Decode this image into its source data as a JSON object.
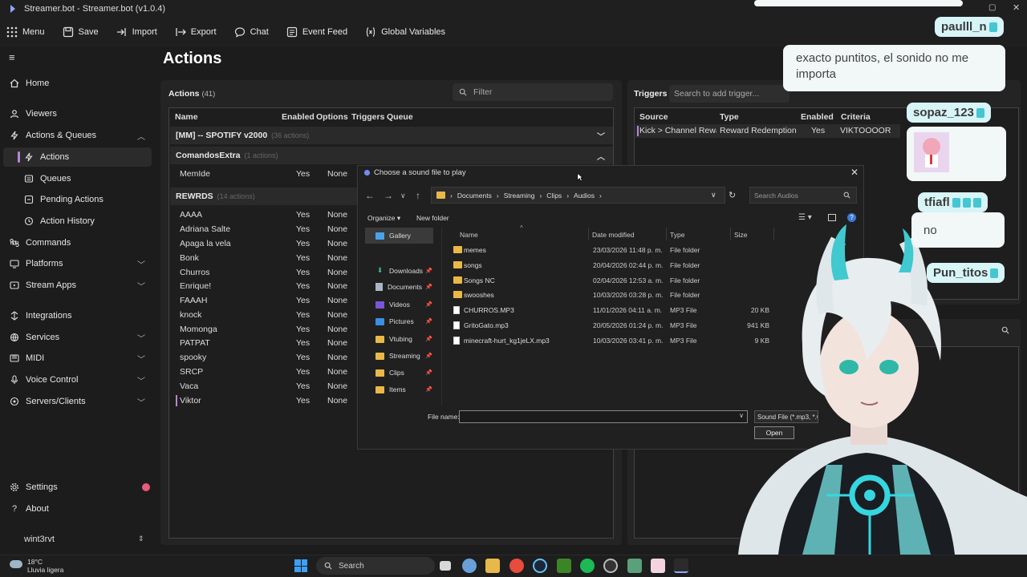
{
  "window": {
    "title": "Streamer.bot - Streamer.bot (v1.0.4)"
  },
  "toolbar": [
    "Menu",
    "Save",
    "Import",
    "Export",
    "Chat",
    "Event Feed",
    "Global Variables"
  ],
  "sidebar": {
    "items": [
      {
        "label": "Home",
        "icon": "home-icon"
      },
      {
        "label": "Viewers",
        "icon": "viewers-icon"
      },
      {
        "label": "Actions & Queues",
        "icon": "bolt-icon",
        "expanded": true
      },
      {
        "label": "Actions",
        "icon": "bolt-icon",
        "active": true
      },
      {
        "label": "Queues",
        "icon": "queue-icon"
      },
      {
        "label": "Pending Actions",
        "icon": "pending-icon"
      },
      {
        "label": "Action History",
        "icon": "history-icon"
      },
      {
        "label": "Commands",
        "icon": "command-icon"
      },
      {
        "label": "Platforms",
        "icon": "platform-icon"
      },
      {
        "label": "Stream Apps",
        "icon": "apps-icon"
      },
      {
        "label": "Integrations",
        "icon": "integrations-icon"
      },
      {
        "label": "Services",
        "icon": "services-icon"
      },
      {
        "label": "MIDI",
        "icon": "midi-icon"
      },
      {
        "label": "Voice Control",
        "icon": "voice-icon"
      },
      {
        "label": "Servers/Clients",
        "icon": "server-icon"
      },
      {
        "label": "Settings",
        "icon": "gear-icon"
      },
      {
        "label": "About",
        "icon": "question-icon"
      }
    ],
    "profile": "wint3rvt"
  },
  "main": {
    "title": "Actions",
    "actions_header": "Actions",
    "actions_count": "(41)",
    "filter_placeholder": "Filter",
    "columns": [
      "Name",
      "Enabled",
      "Options",
      "Triggers",
      "Queue"
    ],
    "groups": [
      {
        "name": "[MM] -- SPOTIFY v2000",
        "count": "(36 actions)"
      },
      {
        "name": "ComandosExtra",
        "count": "(1 actions)",
        "items": [
          {
            "name": "MemIde",
            "enabled": "Yes",
            "options": "None"
          }
        ]
      },
      {
        "name": "REWRDS",
        "count": "(14 actions)",
        "items": [
          {
            "name": "AAAA",
            "enabled": "Yes",
            "options": "None"
          },
          {
            "name": "Adriana Salte",
            "enabled": "Yes",
            "options": "None"
          },
          {
            "name": "Apaga la vela",
            "enabled": "Yes",
            "options": "None"
          },
          {
            "name": "Bonk",
            "enabled": "Yes",
            "options": "None"
          },
          {
            "name": "Churros",
            "enabled": "Yes",
            "options": "None"
          },
          {
            "name": "Enrique!",
            "enabled": "Yes",
            "options": "None"
          },
          {
            "name": "FAAAH",
            "enabled": "Yes",
            "options": "None"
          },
          {
            "name": "knock",
            "enabled": "Yes",
            "options": "None"
          },
          {
            "name": "Momonga",
            "enabled": "Yes",
            "options": "None"
          },
          {
            "name": "PATPAT",
            "enabled": "Yes",
            "options": "None"
          },
          {
            "name": "spooky",
            "enabled": "Yes",
            "options": "None"
          },
          {
            "name": "SRCP",
            "enabled": "Yes",
            "options": "None"
          },
          {
            "name": "Vaca",
            "enabled": "Yes",
            "options": "None"
          },
          {
            "name": "Viktor",
            "enabled": "Yes",
            "options": "None"
          }
        ]
      }
    ]
  },
  "triggers": {
    "header": "Triggers",
    "search_placeholder": "Search to add trigger...",
    "columns": [
      "Source",
      "Type",
      "Enabled",
      "Criteria"
    ],
    "row": {
      "source": "Kick > Channel Reward",
      "type": "Reward Redemption",
      "enabled": "Yes",
      "criteria": "VIKTOOOOR"
    }
  },
  "dialog": {
    "title": "Choose a sound file to play",
    "path": [
      "Documents",
      "Streaming",
      "Clips",
      "Audios"
    ],
    "search_placeholder": "Search Audios",
    "organize": "Organize",
    "new_folder": "New folder",
    "nav": [
      "Gallery",
      "Downloads",
      "Documents",
      "Videos",
      "Pictures",
      "Vtubing",
      "Streaming",
      "Clips",
      "Items"
    ],
    "columns": [
      "Name",
      "Date modified",
      "Type",
      "Size"
    ],
    "files": [
      {
        "name": "memes",
        "date": "23/03/2026 11:48 p. m.",
        "type": "File folder",
        "size": "",
        "kind": "folder"
      },
      {
        "name": "songs",
        "date": "20/04/2026 02:44 p. m.",
        "type": "File folder",
        "size": "",
        "kind": "folder"
      },
      {
        "name": "Songs NC",
        "date": "02/04/2026 12:53 a. m.",
        "type": "File folder",
        "size": "",
        "kind": "folder"
      },
      {
        "name": "swooshes",
        "date": "10/03/2026 03:28 p. m.",
        "type": "File folder",
        "size": "",
        "kind": "folder"
      },
      {
        "name": "CHURROS.MP3",
        "date": "11/01/2026 04:11 a. m.",
        "type": "MP3 File",
        "size": "20 KB",
        "kind": "file"
      },
      {
        "name": "GritoGato.mp3",
        "date": "20/05/2026 01:24 p. m.",
        "type": "MP3 File",
        "size": "941 KB",
        "kind": "file"
      },
      {
        "name": "minecraft-hurt_kg1jeLX.mp3",
        "date": "10/03/2026 03:41 p. m.",
        "type": "MP3 File",
        "size": "9 KB",
        "kind": "file"
      }
    ],
    "filename_label": "File name:",
    "filename_value": "",
    "filetype": "Sound File (*.mp3, *.w",
    "open": "Open"
  },
  "chat": [
    {
      "user": "paulll_n",
      "message": "exacto puntitos, el sonido no me importa"
    },
    {
      "user": "sopaz_123",
      "message": ""
    },
    {
      "user": "tfiafl",
      "message": "no"
    },
    {
      "user": "Pun_titos",
      "message": ""
    }
  ],
  "taskbar": {
    "weather_temp": "18°C",
    "weather_desc": "Lluvia ligera",
    "search": "Search"
  },
  "colors": {
    "accent": "#b784d8",
    "background": "#1c1c1c",
    "panel": "#242424",
    "chat_bubble": "#f2f7f8",
    "chat_name": "#d7f4f7"
  }
}
